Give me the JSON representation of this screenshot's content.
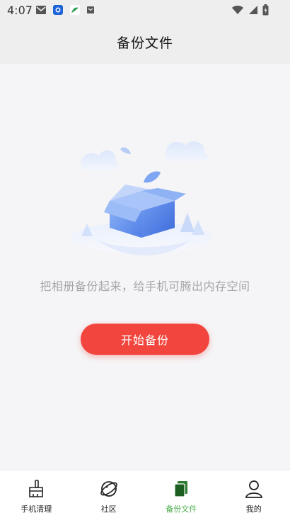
{
  "status_bar": {
    "time": "4:07",
    "icons_left": [
      "gmail-icon",
      "chrome-icon",
      "app-icon",
      "sim-icon"
    ],
    "icons_right": [
      "wifi-icon",
      "signal-icon",
      "battery-icon"
    ]
  },
  "header": {
    "title": "备份文件"
  },
  "main": {
    "illustration": "empty-box-illustration",
    "message": "把相册备份起来，给手机可腾出内存空间",
    "start_button_label": "开始备份"
  },
  "bottom_nav": {
    "items": [
      {
        "label": "手机清理",
        "icon": "broom-icon",
        "active": false
      },
      {
        "label": "社区",
        "icon": "planet-icon",
        "active": false
      },
      {
        "label": "备份文件",
        "icon": "files-icon",
        "active": true
      },
      {
        "label": "我的",
        "icon": "person-icon",
        "active": false
      }
    ]
  },
  "colors": {
    "accent": "#f2453d",
    "active_tab": "#4caf50",
    "illustration_blue": "#5b8def"
  }
}
